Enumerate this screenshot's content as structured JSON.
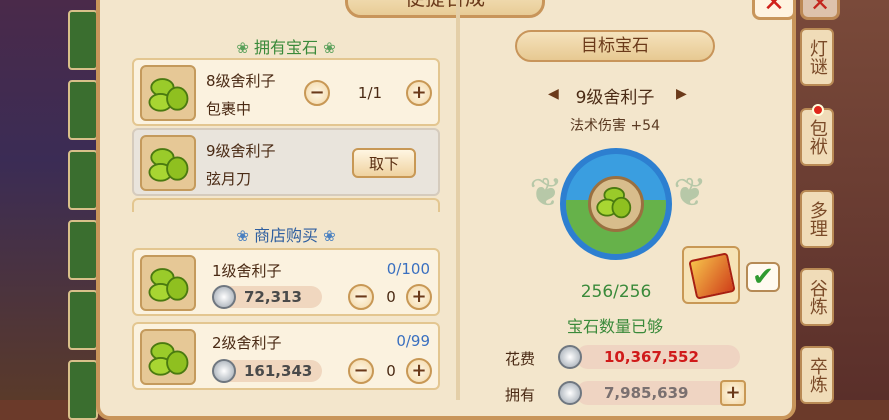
{
  "panel": {
    "title": "便捷合成",
    "close_label": "✕"
  },
  "owned_section": {
    "title": "拥有宝石",
    "items": [
      {
        "name": "8级舍利子",
        "location": "包裹中",
        "count": "1/1",
        "minus": "−",
        "plus": "+"
      },
      {
        "name": "9级舍利子",
        "location": "弦月刀",
        "button": "取下"
      }
    ]
  },
  "shop_section": {
    "title": "商店购买",
    "items": [
      {
        "name": "1级舍利子",
        "quota": "0/100",
        "price": "72,313",
        "count": "0",
        "minus": "−",
        "plus": "+"
      },
      {
        "name": "2级舍利子",
        "quota": "0/99",
        "price": "161,343",
        "count": "0",
        "minus": "−",
        "plus": "+"
      }
    ]
  },
  "target": {
    "header": "目标宝石",
    "name": "9级舍利子",
    "stat": "法术伤害 +54",
    "progress": "256/256",
    "progress_fraction": 1.0,
    "status": "宝石数量已够",
    "checkbox": "✔"
  },
  "cost": {
    "cost_label": "花费",
    "cost_value": "10,367,552",
    "own_label": "拥有",
    "own_value": "7,985,639",
    "plus": "+"
  },
  "side_tabs": [
    "灯谜",
    "包袱",
    "多理",
    "谷炼",
    "卒炼"
  ],
  "colors": {
    "panel_bg": "#f3e6cc",
    "border": "#c8955a",
    "green_text": "#3a8a3a",
    "blue_text": "#3a70c0",
    "red_value": "#d01a1a"
  }
}
